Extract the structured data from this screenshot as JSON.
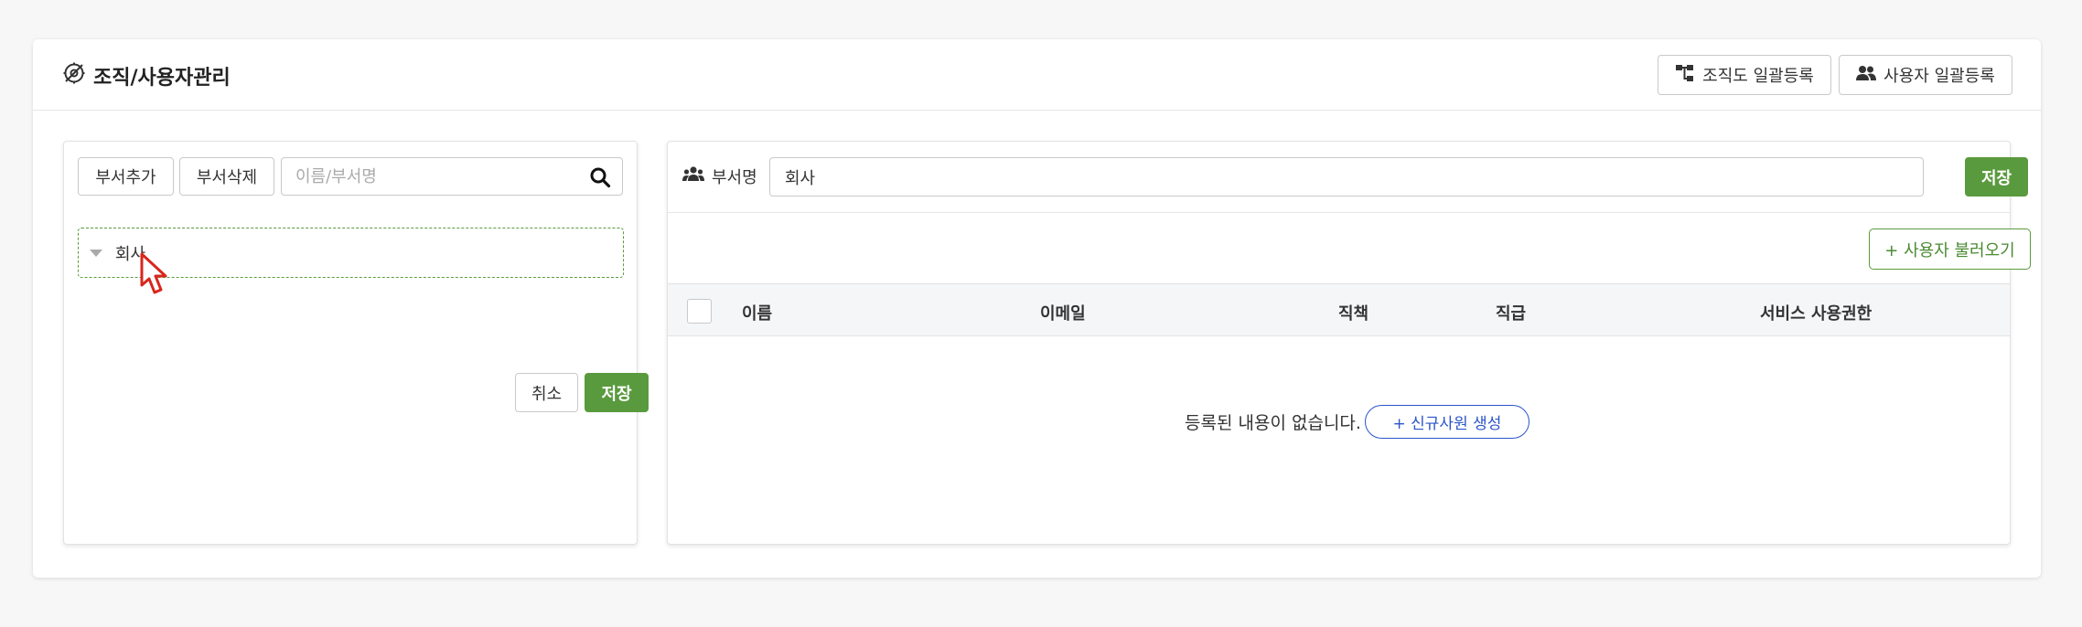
{
  "header": {
    "title": "조직/사용자관리",
    "org_bulk_label": "조직도 일괄등록",
    "user_bulk_label": "사용자 일괄등록"
  },
  "left_panel": {
    "add_dept_label": "부서추가",
    "delete_dept_label": "부서삭제",
    "search_placeholder": "이름/부서명",
    "search_value": "",
    "tree": [
      {
        "label": "회사",
        "expanded": true,
        "selected": true
      }
    ],
    "cancel_label": "취소",
    "save_label": "저장"
  },
  "right_panel": {
    "dept_label": "부서명",
    "dept_value": "회사",
    "save_label": "저장",
    "load_users_label": "+ 사용자 불러오기",
    "table": {
      "columns": [
        "이름",
        "이메일",
        "직책",
        "직급",
        "서비스 사용권한"
      ],
      "rows": []
    },
    "empty_text": "등록된 내용이 없습니다.",
    "new_employee_label": "+ 신규사원 생성"
  },
  "colors": {
    "accent_green": "#5a9a3e",
    "accent_blue": "#2b55c9",
    "cursor_red": "#d8261c"
  },
  "icons": {
    "title": "org-settings-icon",
    "org_bulk": "org-chart-icon",
    "user_bulk": "users-icon",
    "search": "search-icon",
    "dept": "users-group-icon",
    "cursor": "mouse-pointer-icon"
  }
}
